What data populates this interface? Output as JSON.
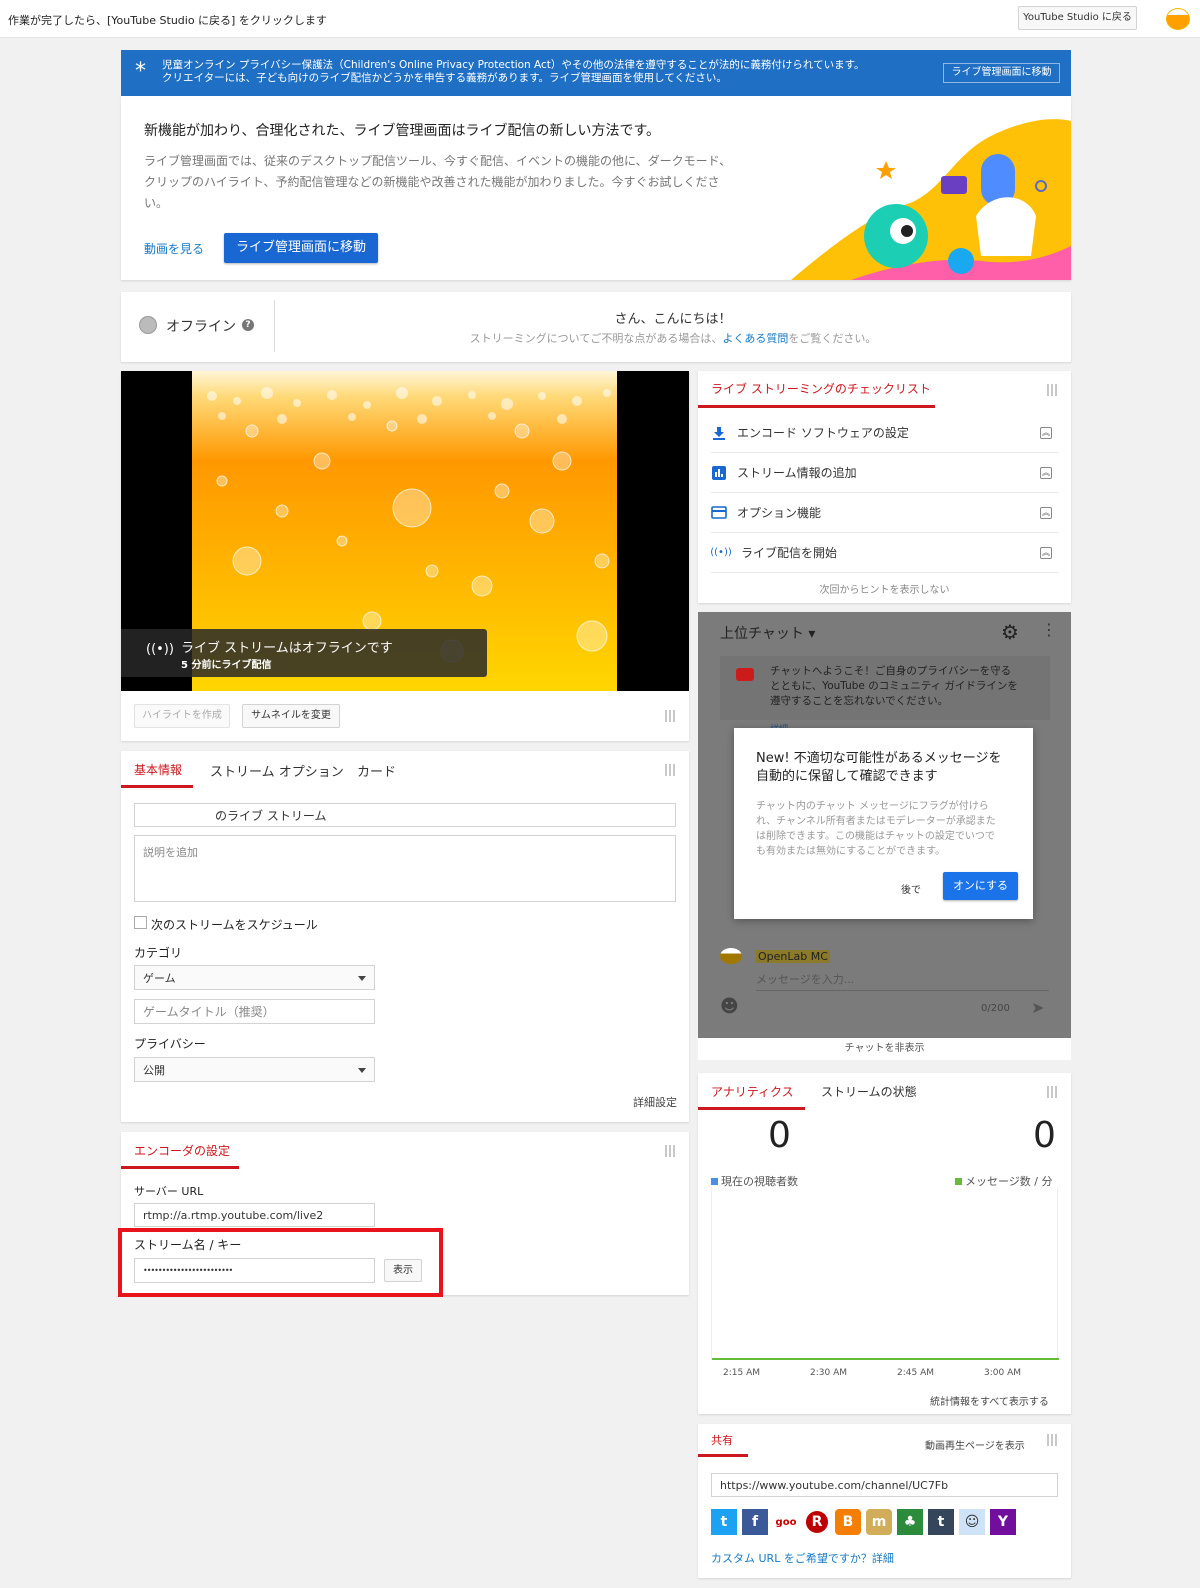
{
  "topbar": {
    "message": "作業が完了したら、[YouTube Studio に戻る] をクリックします",
    "back_button": "YouTube Studio に戻る"
  },
  "coppa": {
    "line1": "児童オンライン プライバシー保護法（Children's Online Privacy Protection Act）やその他の法律を遵守することが法的に義務付けられています。",
    "line2": "クリエイターには、子ども向けのライブ配信かどうかを申告する義務があります。ライブ管理画面を使用してください。",
    "button": "ライブ管理画面に移動"
  },
  "promo": {
    "title": "新機能が加わり、合理化された、ライブ管理画面はライブ配信の新しい方法です。",
    "body_line1": "ライブ管理画面では、従来のデスクトップ配信ツール、今すぐ配信、イベントの機能の他に、ダークモード、",
    "body_line2": "クリップのハイライト、予約配信管理などの新機能や改善された機能が加わりました。今すぐお試しくださ",
    "body_line3": "い。",
    "watch_link": "動画を見る",
    "goto_button": "ライブ管理画面に移動"
  },
  "status": {
    "label": "オフライン",
    "help": "?",
    "greeting": "さん、こんにちは！",
    "faq_prefix": "ストリーミングについてご不明な点がある場合は、",
    "faq_link": "よくある質問",
    "faq_suffix": "をご覧ください。"
  },
  "player": {
    "offline_title": "ライブ ストリームはオフラインです",
    "offline_sub": "5 分前にライブ配信",
    "highlight_button": "ハイライトを作成",
    "thumbnail_button": "サムネイルを変更"
  },
  "info": {
    "tabs": [
      "基本情報",
      "ストリーム オプション",
      "カード"
    ],
    "title_value": "のライブ ストリーム",
    "description_placeholder": "説明を追加",
    "schedule_label": "次のストリームをスケジュール",
    "category_label": "カテゴリ",
    "category_value": "ゲーム",
    "game_title_placeholder": "ゲームタイトル（推奨）",
    "privacy_label": "プライバシー",
    "privacy_value": "公開",
    "advanced_link": "詳細設定"
  },
  "encoder": {
    "tab": "エンコーダの設定",
    "server_label": "サーバー URL",
    "server_value": "rtmp://a.rtmp.youtube.com/live2",
    "key_label": "ストリーム名 / キー",
    "key_value": "••••••••••••••••••••••••",
    "show_button": "表示",
    "highlight_color": "#e8141c"
  },
  "checklist": {
    "title": "ライブ ストリーミングのチェックリスト",
    "items": [
      {
        "icon": "download-icon",
        "label": "エンコード ソフトウェアの設定"
      },
      {
        "icon": "bar-chart-icon",
        "label": "ストリーム情報の追加"
      },
      {
        "icon": "card-icon",
        "label": "オプション機能"
      },
      {
        "icon": "broadcast-icon",
        "label": "ライブ配信を開始"
      }
    ],
    "hide_hints": "次回からヒントを表示しない"
  },
  "chat": {
    "header": "上位チャット",
    "welcome_line1": "チャットへようこそ！ご自身のプライバシーを守る",
    "welcome_line2": "とともに、YouTube のコミュニティ ガイドラインを",
    "welcome_line3": "遵守することを忘れないでください。",
    "welcome_more": "詳細",
    "popup_title_line1": "New! 不適切な可能性があるメッセージを",
    "popup_title_line2": "自動的に保留して確認できます",
    "popup_body_line1": "チャット内のチャット メッセージにフラグが付けら",
    "popup_body_line2": "れ、チャンネル所有者またはモデレーターが承認また",
    "popup_body_line3": "は削除できます。この機能はチャットの設定でいつで",
    "popup_body_line4": "も有効または無効にすることができます。",
    "later_button": "後で",
    "enable_button": "オンにする",
    "user_name": "OpenLab MC",
    "input_placeholder": "メッセージを入力...",
    "counter": "0/200",
    "hide_chat": "チャットを非表示"
  },
  "analytics": {
    "tabs": [
      "アナリティクス",
      "ストリームの状態"
    ],
    "viewers_value": "0",
    "viewers_label": "現在の視聴者数",
    "messages_value": "0",
    "messages_label": "メッセージ数 / 分",
    "times": [
      "2:15 AM",
      "2:30 AM",
      "2:45 AM",
      "3:00 AM"
    ],
    "all_stats_link": "統計情報をすべて表示する",
    "viewer_color": "#4a90e2",
    "message_color": "#66bb3a"
  },
  "share": {
    "tab": "共有",
    "watch_page_link": "動画再生ページを表示",
    "url": "https://www.youtube.com/channel/UC7Fb",
    "icons": [
      {
        "name": "twitter-icon",
        "glyph": "t",
        "color": "#1da1f2"
      },
      {
        "name": "facebook-icon",
        "glyph": "f",
        "color": "#3b5998"
      },
      {
        "name": "goo-icon",
        "glyph": "goo",
        "color": "#ffffff"
      },
      {
        "name": "rakuten-icon",
        "glyph": "R",
        "color": "#bf0000"
      },
      {
        "name": "blogger-icon",
        "glyph": "B",
        "color": "#f57d00"
      },
      {
        "name": "mixi-icon",
        "glyph": "m",
        "color": "#d1ad59"
      },
      {
        "name": "ameba-icon",
        "glyph": "♣",
        "color": "#2d8c3c"
      },
      {
        "name": "tumblr-icon",
        "glyph": "t",
        "color": "#35465c"
      },
      {
        "name": "reddit-icon",
        "glyph": "☺",
        "color": "#cee3f8"
      },
      {
        "name": "yahoo-icon",
        "glyph": "Y",
        "color": "#720e9e"
      }
    ],
    "custom_url": "カスタム URL をご希望ですか？詳細"
  }
}
